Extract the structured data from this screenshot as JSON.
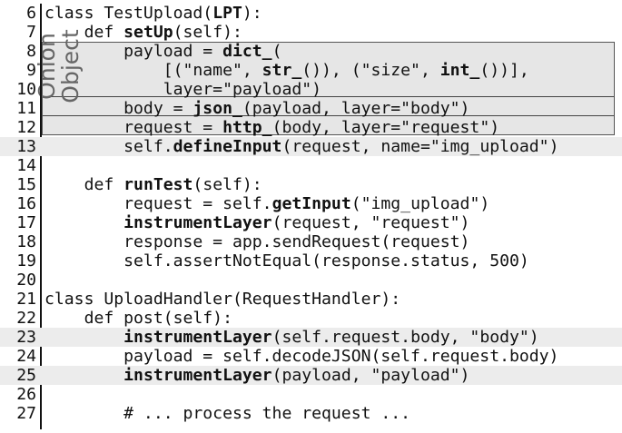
{
  "code_lines": [
    {
      "n": "6",
      "parts": [
        [
          "class TestUpload(",
          false
        ],
        [
          "LPT",
          true
        ],
        [
          "):",
          false
        ]
      ]
    },
    {
      "n": "7",
      "parts": [
        [
          "    def ",
          false
        ],
        [
          "setUp",
          true
        ],
        [
          "(self):",
          false
        ]
      ]
    },
    {
      "n": "8",
      "parts": [
        [
          "        payload = ",
          false
        ],
        [
          "dict_",
          true
        ],
        [
          "(",
          false
        ]
      ]
    },
    {
      "n": "9",
      "parts": [
        [
          "            [(\"name\", ",
          false
        ],
        [
          "str_",
          true
        ],
        [
          "()), (\"size\", ",
          false
        ],
        [
          "int_",
          true
        ],
        [
          "())],",
          false
        ]
      ]
    },
    {
      "n": "10",
      "parts": [
        [
          "            layer=\"payload\")",
          false
        ]
      ]
    },
    {
      "n": "11",
      "parts": [
        [
          "        body = ",
          false
        ],
        [
          "json_",
          true
        ],
        [
          "(payload, layer=\"body\")",
          false
        ]
      ]
    },
    {
      "n": "12",
      "parts": [
        [
          "        request = ",
          false
        ],
        [
          "http_",
          true
        ],
        [
          "(body, layer=\"request\")",
          false
        ]
      ]
    },
    {
      "n": "13",
      "parts": [
        [
          "        self.",
          false
        ],
        [
          "defineInput",
          true
        ],
        [
          "(request, name=\"img_upload\")",
          false
        ]
      ]
    },
    {
      "n": "14",
      "parts": []
    },
    {
      "n": "15",
      "parts": [
        [
          "    def ",
          false
        ],
        [
          "runTest",
          true
        ],
        [
          "(self):",
          false
        ]
      ]
    },
    {
      "n": "16",
      "parts": [
        [
          "        request = self.",
          false
        ],
        [
          "getInput",
          true
        ],
        [
          "(\"img_upload\")",
          false
        ]
      ]
    },
    {
      "n": "17",
      "parts": [
        [
          "        ",
          false
        ],
        [
          "instrumentLayer",
          true
        ],
        [
          "(request, \"request\")",
          false
        ]
      ]
    },
    {
      "n": "18",
      "parts": [
        [
          "        response = app.sendRequest(request)",
          false
        ]
      ]
    },
    {
      "n": "19",
      "parts": [
        [
          "        self.assertNotEqual(response.status, 500)",
          false
        ]
      ]
    },
    {
      "n": "20",
      "parts": []
    },
    {
      "n": "21",
      "parts": [
        [
          "class UploadHandler(RequestHandler):",
          false
        ]
      ]
    },
    {
      "n": "22",
      "parts": [
        [
          "    def post(self):",
          false
        ]
      ]
    },
    {
      "n": "23",
      "parts": [
        [
          "        ",
          false
        ],
        [
          "instrumentLayer",
          true
        ],
        [
          "(self.request.body, \"body\")",
          false
        ]
      ]
    },
    {
      "n": "24",
      "parts": [
        [
          "        payload = self.decodeJSON(self.request.body)",
          false
        ]
      ]
    },
    {
      "n": "25",
      "parts": [
        [
          "        ",
          false
        ],
        [
          "instrumentLayer",
          true
        ],
        [
          "(payload, \"payload\")",
          false
        ]
      ]
    },
    {
      "n": "26",
      "parts": []
    },
    {
      "n": "27",
      "parts": [
        [
          "        # ... process the request ...",
          false
        ]
      ]
    }
  ],
  "highlighted_lines": [
    "13",
    "23",
    "25"
  ],
  "onion_label_1": "Onion",
  "onion_label_2": "Object",
  "colors": {
    "highlight": "#ececec",
    "box": "#e6e6e6",
    "label": "#666666"
  }
}
